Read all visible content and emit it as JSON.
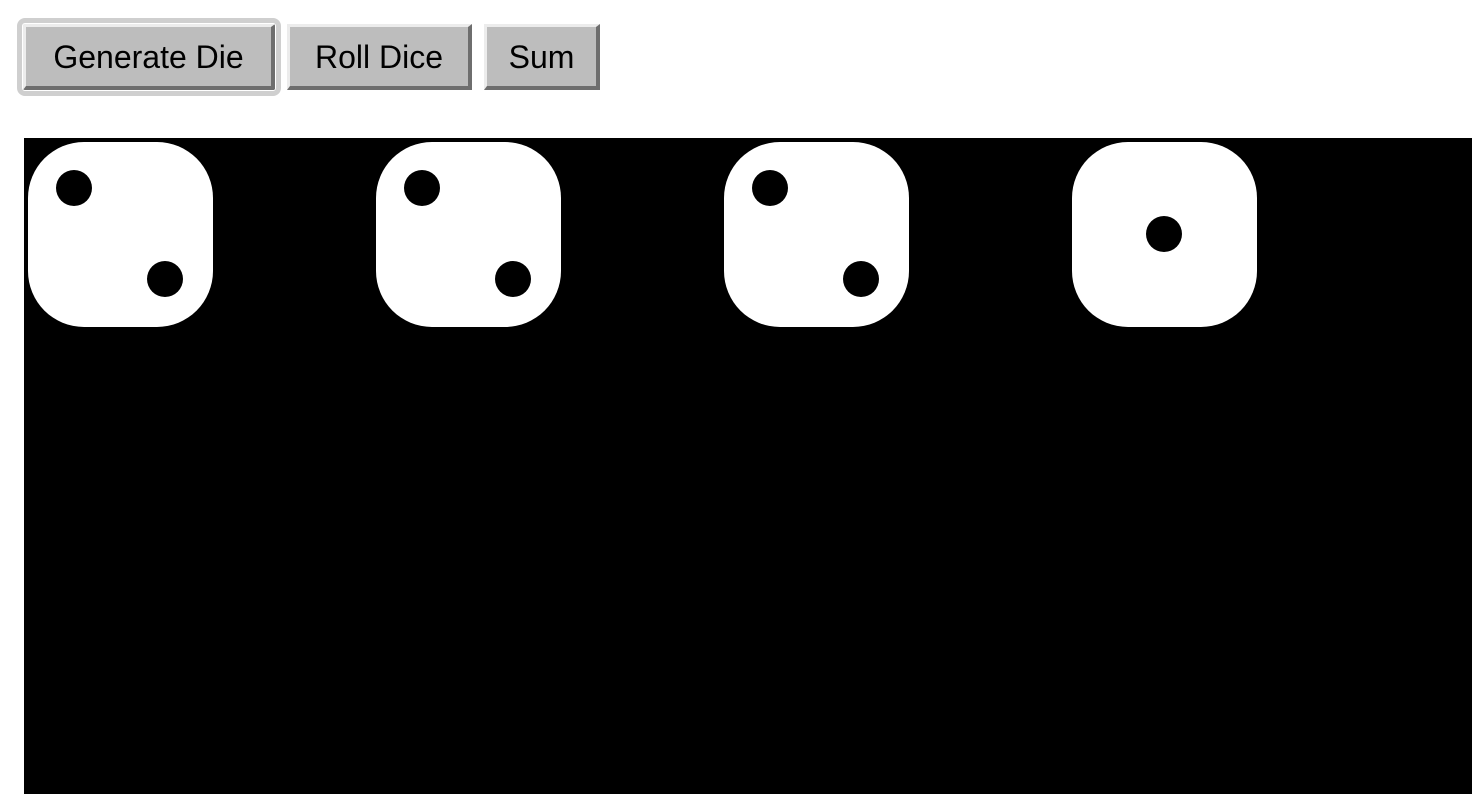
{
  "toolbar": {
    "generate_label": "Generate Die",
    "roll_label": "Roll Dice",
    "sum_label": "Sum"
  },
  "board": {
    "background_color": "#000000",
    "die_color": "#ffffff",
    "pip_color": "#000000",
    "dice": [
      {
        "value": 2
      },
      {
        "value": 2
      },
      {
        "value": 2
      },
      {
        "value": 1
      }
    ]
  }
}
